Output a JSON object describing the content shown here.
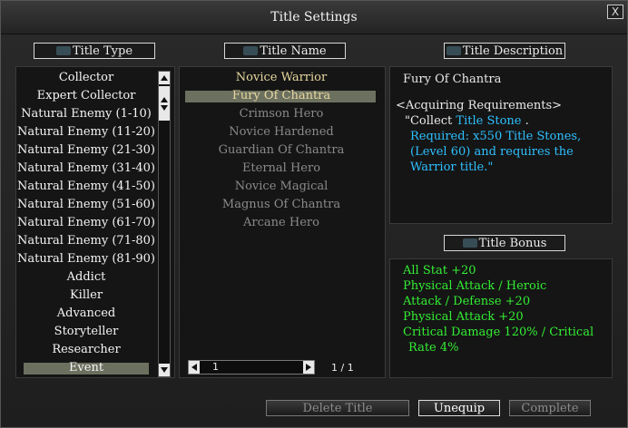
{
  "window": {
    "title": "Title Settings",
    "close_label": "X"
  },
  "headers": {
    "type": "Title Type",
    "name": "Title Name",
    "description": "Title Description",
    "bonus": "Title Bonus"
  },
  "title_types": [
    "Collector",
    "Expert Collector",
    "Natural Enemy (1-10)",
    "Natural Enemy (11-20)",
    "Natural Enemy (21-30)",
    "Natural Enemy (31-40)",
    "Natural Enemy (41-50)",
    "Natural Enemy (51-60)",
    "Natural Enemy (61-70)",
    "Natural Enemy (71-80)",
    "Natural Enemy (81-90)",
    "Addict",
    "Killer",
    "Advanced",
    "Storyteller",
    "Researcher",
    "Event"
  ],
  "selected_type": "Event",
  "title_names": [
    "Novice Warrior",
    "Fury Of Chantra",
    "Crimson Hero",
    "Novice Hardened",
    "Guardian Of Chantra",
    "Eternal Hero",
    "Novice Magical",
    "Magnus Of Chantra",
    "Arcane Hero"
  ],
  "selected_name": "Fury Of Chantra",
  "description": {
    "title": "Fury Of Chantra",
    "req_heading": "<Acquiring Requirements>",
    "collect_prefix": "\"Collect",
    "collect_item": "Title Stone",
    "collect_suffix": ".",
    "required": "Required: x550 Title Stones,",
    "level_prefix": "(Level 60) and requires the",
    "level_suffix": "Warrior title.\""
  },
  "bonus": [
    "All Stat +20",
    "Physical Attack / Heroic",
    "Attack / Defense +20",
    "Physical Attack +20",
    "Critical Damage 120% / Critical",
    "Rate 4%"
  ],
  "pager": {
    "value": "1",
    "count": "1 / 1"
  },
  "buttons": {
    "delete": "Delete Title",
    "unequip": "Unequip",
    "complete": "Complete"
  },
  "colors": {
    "bonus": "#33ee33",
    "highlight": "#2ec0ff",
    "selection": "#8a8f78"
  }
}
